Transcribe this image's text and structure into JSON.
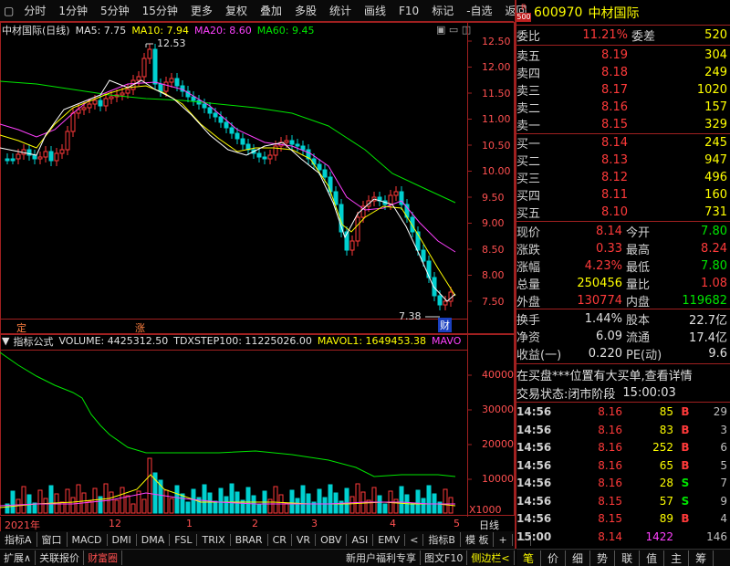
{
  "topbar": {
    "left_tabs": [
      "分时",
      "1分钟",
      "5分钟",
      "15分钟",
      "更多"
    ],
    "right_tabs": [
      "复权",
      "叠加",
      "多股",
      "统计",
      "画线",
      "F10",
      "标记",
      "-自选",
      "返回"
    ]
  },
  "chart_header": {
    "stock_label": "中材国际(日线)",
    "ma5": "MA5: 7.75",
    "ma10": "MA10: 7.94",
    "ma20": "MA20: 8.60",
    "ma60": "MA60: 9.45"
  },
  "price_axis": [
    "12.50",
    "12.00",
    "11.50",
    "11.00",
    "10.50",
    "10.00",
    "9.50",
    "9.00",
    "8.50",
    "8.00",
    "7.50"
  ],
  "annotations": {
    "high": "12.53",
    "low": "7.38",
    "fin_badge": "财",
    "ding_badge": "定",
    "zhang_badge": "涨"
  },
  "indicator_header": {
    "gear": "▼",
    "name": "指标公式",
    "volume": "VOLUME: 4425312.50",
    "tdx": "TDXSTEP100: 11225026.00",
    "mavol1": "MAVOL1: 1649453.38",
    "mavo": "MAVO"
  },
  "volume_axis": [
    "40000",
    "30000",
    "20000",
    "10000"
  ],
  "volume_unit": "X1000",
  "date_axis": [
    "2021年",
    "12",
    "1",
    "2",
    "3",
    "4",
    "5"
  ],
  "period_label": "日线",
  "bottom_tabs": [
    "指标A",
    "窗口",
    "MACD",
    "DMI",
    "DMA",
    "FSL",
    "TRIX",
    "BRAR",
    "CR",
    "VR",
    "OBV",
    "ASI",
    "EMV",
    "<",
    "指标B",
    "模 板",
    "+",
    "−"
  ],
  "footer": {
    "left": [
      "扩展∧",
      "关联报价",
      "财富圈"
    ],
    "middle": [
      "新用户福利专享",
      "图文F10",
      "侧边栏<"
    ],
    "right": [
      "笔",
      "价",
      "细",
      "势",
      "联",
      "值",
      "主",
      "筹"
    ]
  },
  "quote": {
    "r_badge": "R",
    "code_sub": "500",
    "code": "600970",
    "name": "中材国际",
    "weibi_label": "委比",
    "weibi": "11.21%",
    "weicha_label": "委差",
    "weicha": "520",
    "asks": [
      {
        "label": "卖五",
        "price": "8.19",
        "vol": "304"
      },
      {
        "label": "卖四",
        "price": "8.18",
        "vol": "249"
      },
      {
        "label": "卖三",
        "price": "8.17",
        "vol": "1020"
      },
      {
        "label": "卖二",
        "price": "8.16",
        "vol": "157"
      },
      {
        "label": "卖一",
        "price": "8.15",
        "vol": "329"
      }
    ],
    "bids": [
      {
        "label": "买一",
        "price": "8.14",
        "vol": "245"
      },
      {
        "label": "买二",
        "price": "8.13",
        "vol": "947"
      },
      {
        "label": "买三",
        "price": "8.12",
        "vol": "496"
      },
      {
        "label": "买四",
        "price": "8.11",
        "vol": "160"
      },
      {
        "label": "买五",
        "price": "8.10",
        "vol": "731"
      }
    ],
    "stats": [
      {
        "l1": "现价",
        "v1": "8.14",
        "c1": "red",
        "l2": "今开",
        "v2": "7.80",
        "c2": "green"
      },
      {
        "l1": "涨跌",
        "v1": "0.33",
        "c1": "red",
        "l2": "最高",
        "v2": "8.24",
        "c2": "red"
      },
      {
        "l1": "涨幅",
        "v1": "4.23%",
        "c1": "red",
        "l2": "最低",
        "v2": "7.80",
        "c2": "green"
      },
      {
        "l1": "总量",
        "v1": "250456",
        "c1": "yellow",
        "l2": "量比",
        "v2": "1.08",
        "c2": "red"
      },
      {
        "l1": "外盘",
        "v1": "130774",
        "c1": "red",
        "l2": "内盘",
        "v2": "119682",
        "c2": "green"
      }
    ],
    "fund": [
      {
        "l1": "换手",
        "v1": "1.44%",
        "l2": "股本",
        "v2": "22.7亿"
      },
      {
        "l1": "净资",
        "v1": "6.09",
        "l2": "流通",
        "v2": "17.4亿"
      },
      {
        "l1": "收益(一)",
        "v1": "0.220",
        "l2": "PE(动)",
        "v2": "9.6"
      }
    ],
    "notice": "在买盘***位置有大买单,查看详情",
    "trade_status_label": "交易状态:",
    "trade_status": "闭市阶段",
    "trade_time": "15:00:03",
    "ticks": [
      {
        "t": "14:56",
        "p": "8.16",
        "v": "85",
        "f": "B",
        "n": "29"
      },
      {
        "t": "14:56",
        "p": "8.16",
        "v": "83",
        "f": "B",
        "n": "3"
      },
      {
        "t": "14:56",
        "p": "8.16",
        "v": "252",
        "f": "B",
        "n": "6"
      },
      {
        "t": "14:56",
        "p": "8.16",
        "v": "65",
        "f": "B",
        "n": "5"
      },
      {
        "t": "14:56",
        "p": "8.16",
        "v": "28",
        "f": "S",
        "n": "7"
      },
      {
        "t": "14:56",
        "p": "8.15",
        "v": "57",
        "f": "S",
        "n": "9"
      },
      {
        "t": "14:56",
        "p": "8.15",
        "v": "89",
        "f": "B",
        "n": "4"
      },
      {
        "t": "15:00",
        "p": "8.14",
        "v": "1422",
        "f": "",
        "n": "146"
      }
    ]
  },
  "colors": {
    "up": "#ff3a3a",
    "down": "#00d0d0",
    "ma5": "#ffffff",
    "ma10": "#ffff00",
    "ma20": "#ff40ff",
    "ma60": "#00e600",
    "frame": "#a02020"
  }
}
